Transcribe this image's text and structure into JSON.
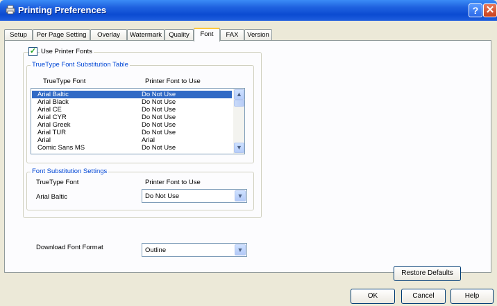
{
  "window": {
    "title": "Printing Preferences",
    "help_label": "?",
    "close_label": "✕",
    "icon": "printer-icon"
  },
  "tabs": [
    "Setup",
    "Per Page Setting",
    "Overlay",
    "Watermark",
    "Quality",
    "Font",
    "FAX",
    "Version"
  ],
  "active_tab": "Font",
  "use_printer_fonts": {
    "label": "Use Printer Fonts",
    "checked": true
  },
  "substitution_table": {
    "title": "TrueType Font Substitution Table",
    "col_truetype": "TrueType Font",
    "col_printer": "Printer Font to Use",
    "rows": [
      {
        "font": "Arial Baltic",
        "printer": "Do Not Use",
        "selected": true
      },
      {
        "font": "Arial Black",
        "printer": "Do Not Use"
      },
      {
        "font": "Arial CE",
        "printer": "Do Not Use"
      },
      {
        "font": "Arial CYR",
        "printer": "Do Not Use"
      },
      {
        "font": "Arial Greek",
        "printer": "Do Not Use"
      },
      {
        "font": "Arial TUR",
        "printer": "Do Not Use"
      },
      {
        "font": "Arial",
        "printer": "Arial"
      },
      {
        "font": "Comic Sans MS",
        "printer": "Do Not Use"
      }
    ]
  },
  "substitution_settings": {
    "title": "Font Substitution Settings",
    "col_truetype": "TrueType Font",
    "col_printer": "Printer Font to Use",
    "current_font": "Arial Baltic",
    "printer_font_value": "Do Not Use"
  },
  "download": {
    "label": "Download Font Format",
    "value": "Outline"
  },
  "buttons": {
    "restore": "Restore Defaults",
    "ok": "OK",
    "cancel": "Cancel",
    "help": "Help"
  },
  "colors": {
    "title_bar": "#0b4bd1",
    "selection": "#316ac5",
    "group_title": "#0046d5",
    "active_tab_accent": "#ffc83c"
  }
}
